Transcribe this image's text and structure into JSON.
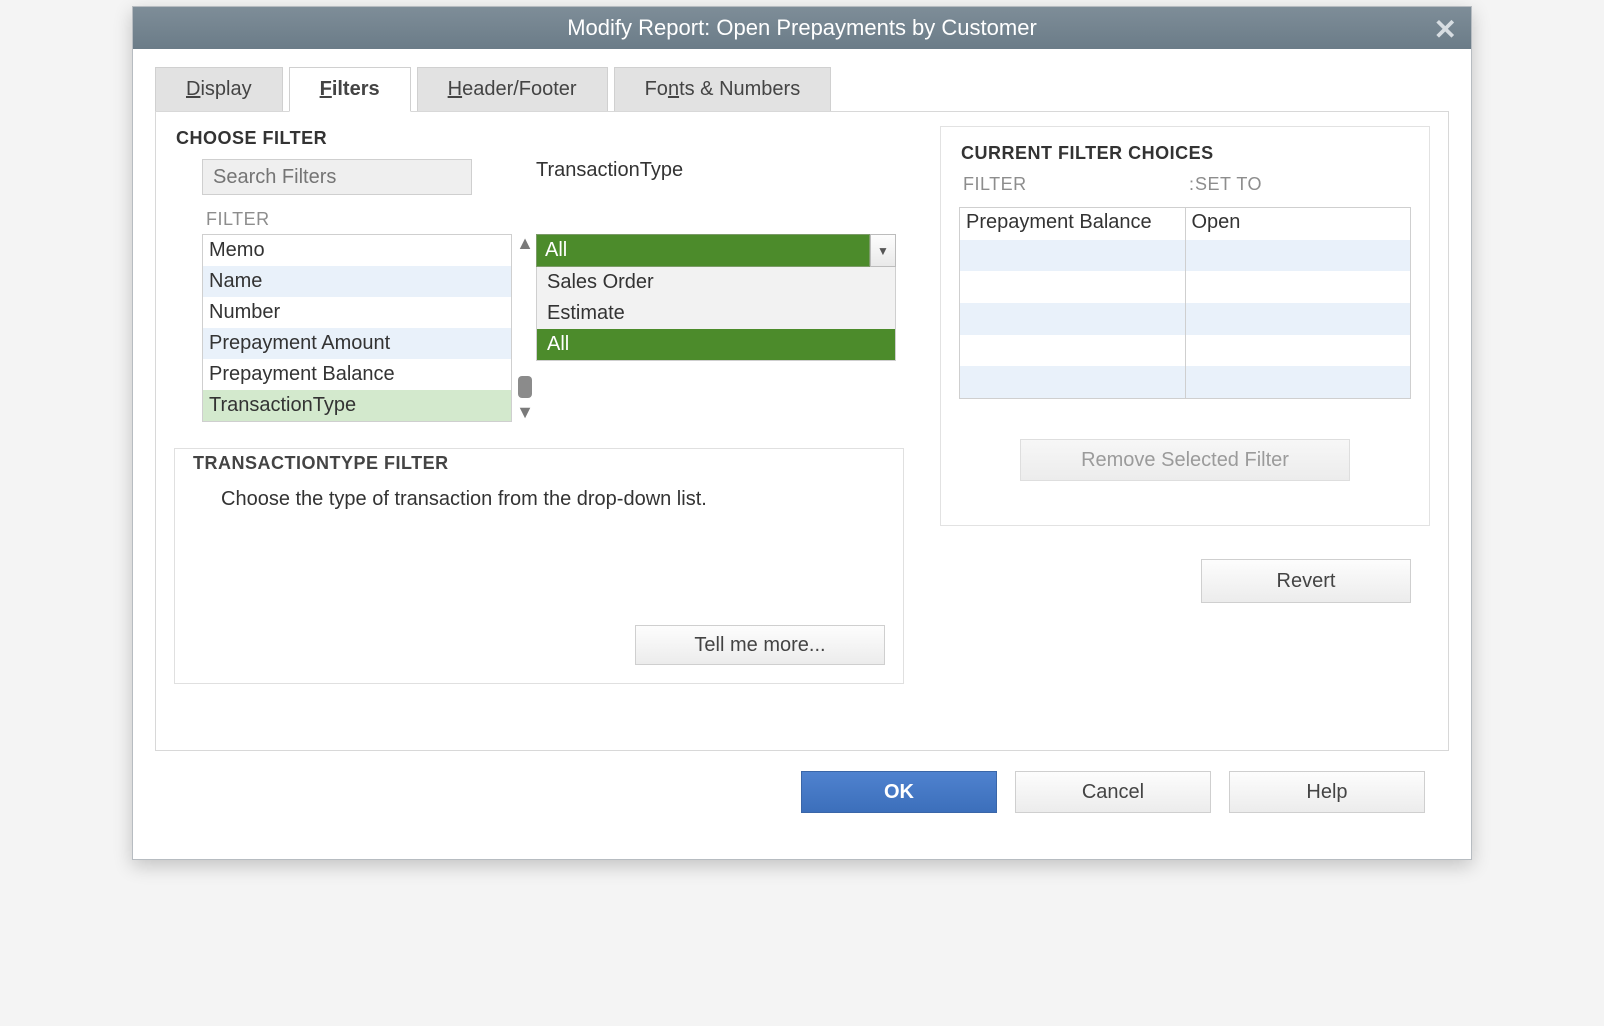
{
  "title": "Modify Report: Open Prepayments by Customer",
  "tabs": {
    "display": "Display",
    "filters": "Filters",
    "headerfooter": "Header/Footer",
    "fonts": "Fonts & Numbers"
  },
  "choose_filter_heading": "CHOOSE FILTER",
  "search_placeholder": "Search Filters",
  "filter_col_head": "FILTER",
  "filter_items": {
    "i0": "Memo",
    "i1": "Name",
    "i2": "Number",
    "i3": "Prepayment Amount",
    "i4": "Prepayment Balance",
    "i5": "TransactionType"
  },
  "type_label": "TransactionType",
  "combo_value": "All",
  "dropdown": {
    "o0": "Sales Order",
    "o1": "Estimate",
    "o2": "All"
  },
  "desc_title": "TRANSACTIONTYPE FILTER",
  "desc_text": "Choose the type of transaction from the drop-down list.",
  "tell_more": "Tell me more...",
  "current_heading": "CURRENT FILTER CHOICES",
  "choices_head_filter": "FILTER",
  "choices_head_setto": "SET TO",
  "choices": {
    "r0": {
      "filter": "Prepayment Balance",
      "setto": "Open"
    }
  },
  "remove_label": "Remove Selected Filter",
  "revert_label": "Revert",
  "buttons": {
    "ok": "OK",
    "cancel": "Cancel",
    "help": "Help"
  }
}
